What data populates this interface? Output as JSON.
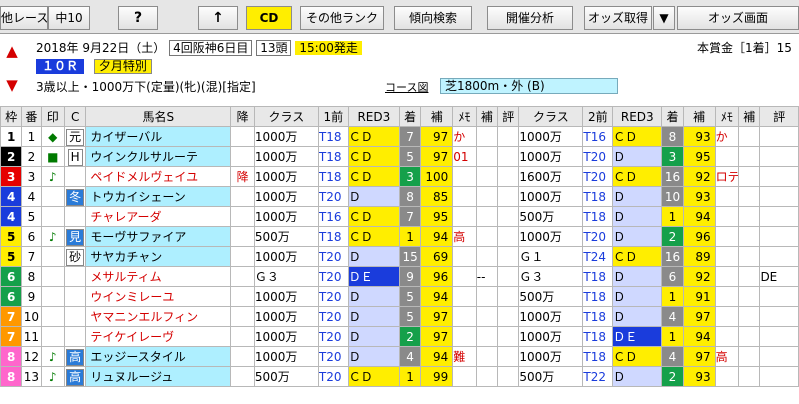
{
  "toolbar": {
    "buttons": [
      {
        "label": "他レース",
        "name": "other-race-button"
      },
      {
        "label": "中10",
        "name": "course-select-button"
      },
      {
        "label": "?",
        "name": "help-button"
      },
      {
        "label": "↑",
        "name": "up-button"
      },
      {
        "label": "CD",
        "name": "cd-button"
      },
      {
        "label": "その他ランク",
        "name": "other-rank-button"
      },
      {
        "label": "傾向検索",
        "name": "trend-search-button"
      },
      {
        "label": "開催分析",
        "name": "meeting-analysis-button"
      },
      {
        "label": "オッズ取得",
        "name": "odds-fetch-button"
      },
      {
        "label": "▼",
        "name": "odds-dropdown-button"
      },
      {
        "label": "オッズ画面",
        "name": "odds-screen-button"
      }
    ]
  },
  "race": {
    "date": "2018年 9月22日（土）",
    "meeting": "4回阪神6日目",
    "runners": "13頭",
    "start": "15:00発走",
    "prize": "本賞金［1着］15",
    "number": "１０Ｒ",
    "name": "夕月特別",
    "conditions": "3歳以上・1000万下(定量)(牝)(混)[指定]",
    "course_label": "コース図",
    "course": "芝1800m・外 (B)"
  },
  "headers": [
    "枠",
    "番",
    "印",
    "C",
    "馬名S",
    "降",
    "クラス",
    "1前",
    "RED3",
    "着",
    "補",
    "ﾒﾓ",
    "補",
    "評",
    "クラス",
    "2前",
    "RED3",
    "着",
    "補",
    "ﾒﾓ",
    "補",
    "評"
  ],
  "colors": {
    "accent": "#ffee00",
    "header_red": "#ffb0b0",
    "header_blue": "#c7ecff",
    "name_cyan": "#aeefff"
  },
  "rows": [
    {
      "waku": "1",
      "num": "1",
      "mark": "◆",
      "c": "元",
      "name": "カイザーバル",
      "fall": "",
      "cls1": "1000万",
      "t1": "T18",
      "r1": "ＣＤ",
      "ch1": "7",
      "h1": "97",
      "m1": "か",
      "hb1": "",
      "ev1": "",
      "cls2": "1000万",
      "t2": "T16",
      "r2": "ＣＤ",
      "ch2": "8",
      "h2": "93",
      "m2": "か",
      "hb2": "",
      "ev2": ""
    },
    {
      "waku": "2",
      "num": "2",
      "mark": "■",
      "c": "H",
      "name": "ウインクルサルーテ",
      "fall": "",
      "cls1": "1000万",
      "t1": "T18",
      "r1": "ＣＤ",
      "ch1": "5",
      "h1": "97",
      "m1": "01",
      "hb1": "",
      "ev1": "",
      "cls2": "1000万",
      "t2": "T20",
      "r2": "Ｄ",
      "ch2": "3",
      "h2": "95",
      "m2": "",
      "hb2": "",
      "ev2": ""
    },
    {
      "waku": "3",
      "num": "3",
      "mark": "♪",
      "c": "",
      "name": "ペイドメルヴェイユ",
      "fall": "降",
      "cls1": "1000万",
      "t1": "T18",
      "r1": "ＣＤ",
      "ch1": "3",
      "h1": "100",
      "m1": "",
      "hb1": "",
      "ev1": "",
      "cls2": "1600万",
      "t2": "T20",
      "r2": "ＣＤ",
      "ch2": "16",
      "h2": "92",
      "m2": "ロテ",
      "hb2": "",
      "ev2": ""
    },
    {
      "waku": "4",
      "num": "4",
      "mark": "",
      "c": "冬",
      "name": "トウカイシェーン",
      "fall": "",
      "cls1": "1000万",
      "t1": "T20",
      "r1": "Ｄ",
      "ch1": "8",
      "h1": "85",
      "m1": "",
      "hb1": "",
      "ev1": "",
      "cls2": "1000万",
      "t2": "T18",
      "r2": "Ｄ",
      "ch2": "10",
      "h2": "93",
      "m2": "",
      "hb2": "",
      "ev2": ""
    },
    {
      "waku": "4",
      "num": "5",
      "mark": "",
      "c": "",
      "name": "チャレアーダ",
      "fall": "",
      "cls1": "1000万",
      "t1": "T16",
      "r1": "ＣＤ",
      "ch1": "7",
      "h1": "95",
      "m1": "",
      "hb1": "",
      "ev1": "",
      "cls2": "500万",
      "t2": "T18",
      "r2": "Ｄ",
      "ch2": "1",
      "h2": "94",
      "m2": "",
      "hb2": "",
      "ev2": ""
    },
    {
      "waku": "5",
      "num": "6",
      "mark": "♪",
      "c": "見",
      "name": "モーヴサファイア",
      "fall": "",
      "cls1": "500万",
      "t1": "T18",
      "r1": "ＣＤ",
      "ch1": "1",
      "h1": "94",
      "m1": "高",
      "hb1": "",
      "ev1": "",
      "cls2": "1000万",
      "t2": "T20",
      "r2": "Ｄ",
      "ch2": "2",
      "h2": "96",
      "m2": "",
      "hb2": "",
      "ev2": ""
    },
    {
      "waku": "5",
      "num": "7",
      "mark": "",
      "c": "砂",
      "name": "サヤカチャン",
      "fall": "",
      "cls1": "1000万",
      "t1": "T20",
      "r1": "Ｄ",
      "ch1": "15",
      "h1": "69",
      "m1": "",
      "hb1": "",
      "ev1": "",
      "cls2": "Ｇ１",
      "t2": "T24",
      "r2": "ＣＤ",
      "ch2": "16",
      "h2": "89",
      "m2": "",
      "hb2": "",
      "ev2": ""
    },
    {
      "waku": "6",
      "num": "8",
      "mark": "",
      "c": "",
      "name": "メサルティム",
      "fall": "",
      "cls1": "Ｇ３",
      "t1": "T20",
      "r1": "ＤＥ",
      "ch1": "9",
      "h1": "96",
      "m1": "",
      "hb1": "--",
      "ev1": "",
      "cls2": "Ｇ３",
      "t2": "T18",
      "r2": "Ｄ",
      "ch2": "6",
      "h2": "92",
      "m2": "",
      "hb2": "",
      "ev2": "DE"
    },
    {
      "waku": "6",
      "num": "9",
      "mark": "",
      "c": "",
      "name": "ウインミレーユ",
      "fall": "",
      "cls1": "1000万",
      "t1": "T20",
      "r1": "Ｄ",
      "ch1": "5",
      "h1": "94",
      "m1": "",
      "hb1": "",
      "ev1": "",
      "cls2": "500万",
      "t2": "T18",
      "r2": "Ｄ",
      "ch2": "1",
      "h2": "91",
      "m2": "",
      "hb2": "",
      "ev2": ""
    },
    {
      "waku": "7",
      "num": "10",
      "mark": "",
      "c": "",
      "name": "ヤマニンエルフィン",
      "fall": "",
      "cls1": "1000万",
      "t1": "T20",
      "r1": "Ｄ",
      "ch1": "5",
      "h1": "97",
      "m1": "",
      "hb1": "",
      "ev1": "",
      "cls2": "1000万",
      "t2": "T18",
      "r2": "Ｄ",
      "ch2": "4",
      "h2": "97",
      "m2": "",
      "hb2": "",
      "ev2": ""
    },
    {
      "waku": "7",
      "num": "11",
      "mark": "",
      "c": "",
      "name": "テイケイレーヴ",
      "fall": "",
      "cls1": "1000万",
      "t1": "T20",
      "r1": "Ｄ",
      "ch1": "2",
      "h1": "97",
      "m1": "",
      "hb1": "",
      "ev1": "",
      "cls2": "1000万",
      "t2": "T18",
      "r2": "ＤＥ",
      "ch2": "1",
      "h2": "94",
      "m2": "",
      "hb2": "",
      "ev2": ""
    },
    {
      "waku": "8",
      "num": "12",
      "mark": "♪",
      "c": "高",
      "name": "エッジースタイル",
      "fall": "",
      "cls1": "1000万",
      "t1": "T20",
      "r1": "Ｄ",
      "ch1": "4",
      "h1": "94",
      "m1": "難",
      "hb1": "",
      "ev1": "",
      "cls2": "1000万",
      "t2": "T18",
      "r2": "ＣＤ",
      "ch2": "4",
      "h2": "97",
      "m2": "高",
      "hb2": "",
      "ev2": ""
    },
    {
      "waku": "8",
      "num": "13",
      "mark": "♪",
      "c": "高",
      "name": "リュヌルージュ",
      "fall": "",
      "cls1": "500万",
      "t1": "T20",
      "r1": "ＣＤ",
      "ch1": "1",
      "h1": "99",
      "m1": "",
      "hb1": "",
      "ev1": "",
      "cls2": "500万",
      "t2": "T22",
      "r2": "Ｄ",
      "ch2": "2",
      "h2": "93",
      "m2": "",
      "hb2": "",
      "ev2": ""
    }
  ]
}
